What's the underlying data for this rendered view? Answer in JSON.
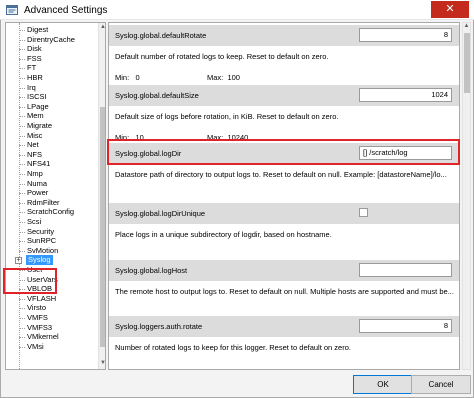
{
  "window": {
    "title": "Advanced Settings",
    "close_glyph": "✕"
  },
  "tree": {
    "items": [
      {
        "label": "Digest"
      },
      {
        "label": "DirentryCache"
      },
      {
        "label": "Disk"
      },
      {
        "label": "FSS"
      },
      {
        "label": "FT"
      },
      {
        "label": "HBR"
      },
      {
        "label": "Irq"
      },
      {
        "label": "ISCSI"
      },
      {
        "label": "LPage"
      },
      {
        "label": "Mem"
      },
      {
        "label": "Migrate"
      },
      {
        "label": "Misc"
      },
      {
        "label": "Net"
      },
      {
        "label": "NFS"
      },
      {
        "label": "NFS41"
      },
      {
        "label": "Nmp"
      },
      {
        "label": "Numa"
      },
      {
        "label": "Power"
      },
      {
        "label": "RdmFilter"
      },
      {
        "label": "ScratchConfig"
      },
      {
        "label": "Scsi"
      },
      {
        "label": "Security"
      },
      {
        "label": "SunRPC"
      },
      {
        "label": "SvMotion"
      },
      {
        "label": "Syslog",
        "expander": "+",
        "selected": true
      },
      {
        "label": "User"
      },
      {
        "label": "UserVars"
      },
      {
        "label": "VBLOB"
      },
      {
        "label": "VFLASH"
      },
      {
        "label": "Virsto"
      },
      {
        "label": "VMFS"
      },
      {
        "label": "VMFS3"
      },
      {
        "label": "VMkernel"
      },
      {
        "label": "VMsi"
      }
    ]
  },
  "settings": [
    {
      "name": "Syslog.global.defaultRotate",
      "value": "8",
      "control": "number",
      "description": "Default number of rotated logs to keep. Reset to default on zero.",
      "min_label": "Min:",
      "min": "0",
      "max_label": "Max:",
      "max": "100"
    },
    {
      "name": "Syslog.global.defaultSize",
      "value": "1024",
      "control": "number",
      "description": "Default size of logs before rotation, in KiB. Reset to default on zero.",
      "min_label": "Min:",
      "min": "10",
      "max_label": "Max:",
      "max": "10240"
    },
    {
      "name": "Syslog.global.logDir",
      "value": "[] /scratch/log",
      "control": "text",
      "description": "Datastore path of directory to output logs to. Reset to default on null. Example: [datastoreName]/lo..."
    },
    {
      "name": "Syslog.global.logDirUnique",
      "control": "checkbox",
      "description": "Place logs in a unique subdirectory of logdir, based on hostname."
    },
    {
      "name": "Syslog.global.logHost",
      "value": "",
      "control": "text",
      "description": "The remote host to output logs to. Reset to default on null. Multiple hosts are supported and must be..."
    },
    {
      "name": "Syslog.loggers.auth.rotate",
      "value": "8",
      "control": "number",
      "description": "Number of rotated logs to keep for this logger. Reset to default on zero."
    }
  ],
  "buttons": {
    "ok": "OK",
    "cancel": "Cancel"
  },
  "icons": {
    "app": "settings-window-icon",
    "scroll_up": "▲",
    "scroll_down": "▼"
  },
  "colors": {
    "highlight": "#e0232a",
    "selection": "#3399ff",
    "row_header": "#dcdcdc"
  }
}
